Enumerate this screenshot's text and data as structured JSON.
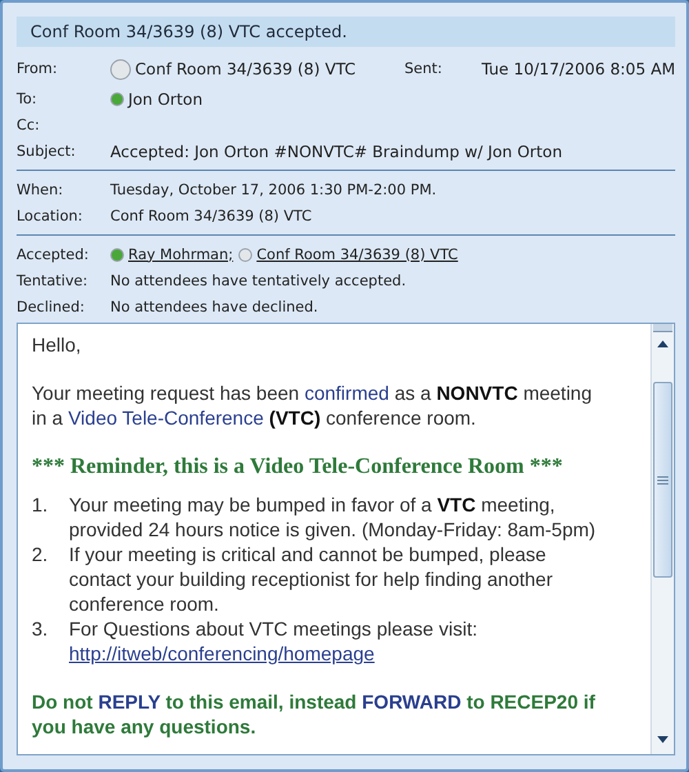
{
  "header": {
    "title": "Conf Room 34/3639 (8) VTC accepted."
  },
  "from": {
    "label": "From:",
    "name": "Conf Room 34/3639 (8) VTC",
    "color": "#e4e7ea"
  },
  "sent": {
    "label": "Sent:",
    "value": "Tue 10/17/2006 8:05 AM"
  },
  "to": {
    "label": "To:",
    "name": "Jon Orton",
    "color": "#4aa83a"
  },
  "cc": {
    "label": "Cc:"
  },
  "subject": {
    "label": "Subject:",
    "value": "Accepted: Jon Orton #NONVTC# Braindump w/ Jon Orton"
  },
  "when": {
    "label": "When:",
    "value": "Tuesday, October 17, 2006 1:30 PM-2:00 PM."
  },
  "location": {
    "label": "Location:",
    "value": "Conf Room 34/3639 (8) VTC"
  },
  "accepted": {
    "label": "Accepted:",
    "attendees": [
      {
        "name": "Ray Mohrman;",
        "color": "#4aa83a"
      },
      {
        "name": "Conf Room 34/3639 (8) VTC",
        "color": "#e4e7ea"
      }
    ]
  },
  "tentative": {
    "label": "Tentative:",
    "value": "No attendees have tentatively accepted."
  },
  "declined": {
    "label": "Declined:",
    "value": "No attendees have declined."
  },
  "body": [
    {
      "kind": "text",
      "segments": [
        {
          "kind": "plain",
          "text": "Hello,"
        }
      ]
    },
    {
      "kind": "text",
      "segments": [
        {
          "kind": "plain",
          "text": "Your meeting request has been "
        },
        {
          "kind": "link",
          "text": "confirmed"
        },
        {
          "kind": "plain",
          "text": " as a "
        },
        {
          "kind": "bold",
          "text": "NONVTC"
        },
        {
          "kind": "plain",
          "text": " meeting in a "
        },
        {
          "kind": "link",
          "text": "Video Tele-Conference"
        },
        {
          "kind": "bold",
          "text": " (VTC)"
        },
        {
          "kind": "plain",
          "text": " conference room."
        }
      ]
    },
    {
      "kind": "heading",
      "segments": [
        {
          "kind": "plain",
          "text": "*** Reminder, this is a Video Tele-Conference Room ***"
        }
      ]
    },
    {
      "kind": "list",
      "items": [
        {
          "number": "1.",
          "segments": [
            {
              "kind": "plain",
              "text": "Your meeting may be bumped in favor of a "
            },
            {
              "kind": "bold",
              "text": "VTC"
            },
            {
              "kind": "plain",
              "text": " meeting, provided 24 hours notice is given. (Monday-Friday: 8am-5pm)"
            }
          ]
        },
        {
          "number": "2.",
          "segments": [
            {
              "kind": "plain",
              "text": "If your meeting is critical and cannot be bumped, please contact your building receptionist for help finding another conference room."
            }
          ]
        },
        {
          "number": "3.",
          "segments": [
            {
              "kind": "plain",
              "text": "For Questions about VTC meetings please visit: "
            },
            {
              "kind": "url",
              "text": "http://itweb/conferencing/homepage"
            }
          ]
        }
      ]
    },
    {
      "kind": "notice",
      "segments": [
        {
          "kind": "plain",
          "text": "Do not "
        },
        {
          "kind": "link",
          "text": "REPLY"
        },
        {
          "kind": "plain",
          "text": " to this email, instead "
        },
        {
          "kind": "link",
          "text": "FORWARD"
        },
        {
          "kind": "plain",
          "text": " to RECEP20 if you have any questions."
        }
      ]
    }
  ]
}
